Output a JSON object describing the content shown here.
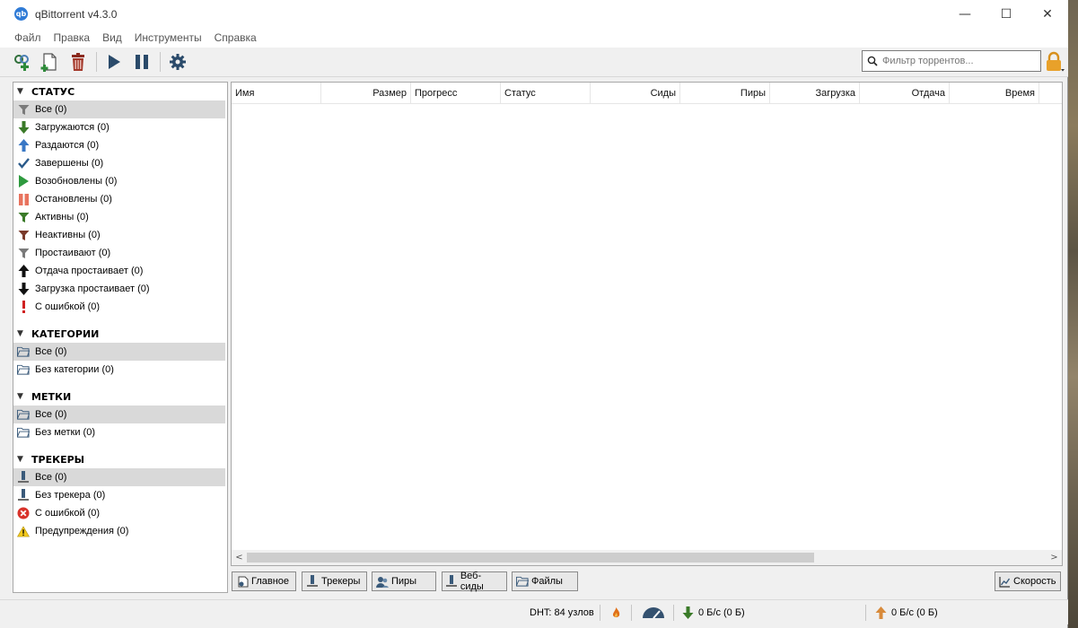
{
  "window": {
    "title": "qBittorrent v4.3.0",
    "logo_text": "qb",
    "controls": {
      "minimize": "—",
      "maximize": "☐",
      "close": "✕"
    }
  },
  "menu": [
    "Файл",
    "Правка",
    "Вид",
    "Инструменты",
    "Справка"
  ],
  "toolbar": {
    "filter_placeholder": "Фильтр торрентов...",
    "icons": [
      "add-link-icon",
      "add-file-icon",
      "delete-icon",
      "play-icon",
      "pause-icon",
      "gear-icon"
    ]
  },
  "sidebar": {
    "status": {
      "title": "СТАТУС",
      "items": [
        {
          "label": "Все (0)",
          "icon": "filter-gray-icon"
        },
        {
          "label": "Загружаются (0)",
          "icon": "arrow-down-green-icon"
        },
        {
          "label": "Раздаются (0)",
          "icon": "arrow-up-blue-icon"
        },
        {
          "label": "Завершены (0)",
          "icon": "checkmark-icon"
        },
        {
          "label": "Возобновлены (0)",
          "icon": "play-green-icon"
        },
        {
          "label": "Остановлены (0)",
          "icon": "pause-red-icon"
        },
        {
          "label": "Активны (0)",
          "icon": "filter-green-icon"
        },
        {
          "label": "Неактивны (0)",
          "icon": "filter-red-icon"
        },
        {
          "label": "Простаивают (0)",
          "icon": "filter-gray-icon"
        },
        {
          "label": "Отдача простаивает (0)",
          "icon": "arrow-up-black-icon"
        },
        {
          "label": "Загрузка простаивает (0)",
          "icon": "arrow-down-black-icon"
        },
        {
          "label": "С ошибкой (0)",
          "icon": "exclamation-icon"
        }
      ]
    },
    "categories": {
      "title": "КАТЕГОРИИ",
      "items": [
        {
          "label": "Все (0)",
          "icon": "folder-icon"
        },
        {
          "label": "Без категории (0)",
          "icon": "folder-icon"
        }
      ]
    },
    "tags": {
      "title": "МЕТКИ",
      "items": [
        {
          "label": "Все (0)",
          "icon": "folder-icon"
        },
        {
          "label": "Без метки (0)",
          "icon": "folder-icon"
        }
      ]
    },
    "trackers": {
      "title": "ТРЕКЕРЫ",
      "items": [
        {
          "label": "Все (0)",
          "icon": "tracker-icon"
        },
        {
          "label": "Без трекера (0)",
          "icon": "tracker-icon"
        },
        {
          "label": "С ошибкой (0)",
          "icon": "error-circle-icon"
        },
        {
          "label": "Предупреждения (0)",
          "icon": "warning-icon"
        }
      ]
    }
  },
  "table": {
    "columns": [
      "Имя",
      "Размер",
      "Прогресс",
      "Статус",
      "Сиды",
      "Пиры",
      "Загрузка",
      "Отдача",
      "Время"
    ],
    "scroll_left": "<",
    "scroll_right": ">"
  },
  "bottom_tabs": [
    {
      "label": "Главное",
      "icon": "general-icon"
    },
    {
      "label": "Трекеры",
      "icon": "tracker-icon"
    },
    {
      "label": "Пиры",
      "icon": "peers-icon"
    },
    {
      "label": "Веб-сиды",
      "icon": "webseed-icon"
    },
    {
      "label": "Файлы",
      "icon": "files-icon"
    },
    {
      "label": "Скорость",
      "icon": "speed-chart-icon"
    }
  ],
  "statusbar": {
    "dht": "DHT: 84 узлов",
    "download": "0 Б/с (0 Б)",
    "upload": "0 Б/с (0 Б)"
  }
}
